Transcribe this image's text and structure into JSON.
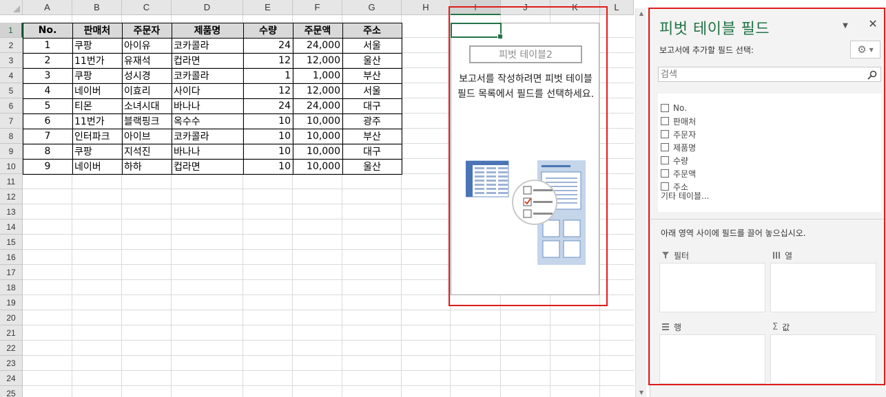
{
  "sheet": {
    "columns": [
      "A",
      "B",
      "C",
      "D",
      "E",
      "F",
      "G",
      "H",
      "I",
      "J",
      "K",
      "L"
    ],
    "active_column": "I",
    "rows": [
      "1",
      "2",
      "3",
      "4",
      "5",
      "6",
      "7",
      "8",
      "9",
      "10",
      "11",
      "12",
      "13",
      "14",
      "15",
      "16",
      "17",
      "18",
      "19",
      "20",
      "21",
      "22",
      "23",
      "24",
      "25"
    ],
    "active_row": "1",
    "table": {
      "headers": [
        "No.",
        "판매처",
        "주문자",
        "제품명",
        "수량",
        "주문액",
        "주소"
      ],
      "rows": [
        [
          "1",
          "쿠팡",
          "아이유",
          "코카콜라",
          "24",
          "24,000",
          "서울"
        ],
        [
          "2",
          "11번가",
          "유재석",
          "컵라면",
          "12",
          "12,000",
          "울산"
        ],
        [
          "3",
          "쿠팡",
          "성시경",
          "코카콜라",
          "1",
          "1,000",
          "부산"
        ],
        [
          "4",
          "네이버",
          "이효리",
          "사이다",
          "12",
          "12,000",
          "서울"
        ],
        [
          "5",
          "티몬",
          "소녀시대",
          "바나나",
          "24",
          "24,000",
          "대구"
        ],
        [
          "6",
          "11번가",
          "블랙핑크",
          "옥수수",
          "10",
          "10,000",
          "광주"
        ],
        [
          "7",
          "인터파크",
          "아이브",
          "코카콜라",
          "10",
          "10,000",
          "부산"
        ],
        [
          "8",
          "쿠팡",
          "지석진",
          "바나나",
          "10",
          "10,000",
          "대구"
        ],
        [
          "9",
          "네이버",
          "하하",
          "컵라면",
          "10",
          "10,000",
          "울산"
        ]
      ]
    }
  },
  "pivot_placeholder": {
    "title": "피벗 테이블2",
    "instruction": "보고서를 작성하려면 피벗 테이블 필드 목록에서 필드를 선택하세요."
  },
  "panel": {
    "title": "피벗 테이블 필드",
    "choose_label": "보고서에 추가할 필드 선택:",
    "search_placeholder": "검색",
    "fields": [
      "No.",
      "판매처",
      "주문자",
      "제품명",
      "수량",
      "주문액",
      "주소"
    ],
    "more_tables": "기타 테이블...",
    "drag_instruction": "아래 영역 사이에 필드를 끌어 놓으십시오.",
    "areas": {
      "filter": "필터",
      "columns": "열",
      "rows": "행",
      "values": "값"
    }
  },
  "colors": {
    "accent": "#217346",
    "highlight_border": "#e01b1b",
    "header_fill": "#d9d9d9"
  }
}
